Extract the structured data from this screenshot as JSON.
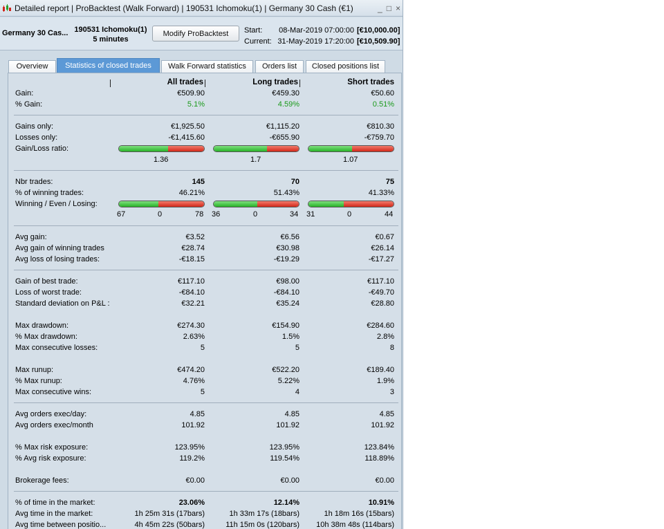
{
  "window": {
    "title": "Detailed report | ProBacktest (Walk Forward) | 190531 Ichomoku(1) | Germany 30 Cash (€1)",
    "minimize": "_",
    "maximize": "□",
    "close": "×"
  },
  "info": {
    "instrument": "Germany 30 Cas...",
    "system_name": "190531 Ichomoku(1)",
    "timeframe": "5 minutes",
    "modify_button": "Modify ProBacktest",
    "start_label": "Start:",
    "start_date": "08-Mar-2019 07:00:00",
    "start_amount": "[€10,000.00]",
    "current_label": "Current:",
    "current_date": "31-May-2019 17:20:00",
    "current_amount": "[€10,509.90]"
  },
  "tabs": [
    "Overview",
    "Statistics of closed trades",
    "Walk Forward statistics",
    "Orders list",
    "Closed positions list"
  ],
  "columns": [
    "All trades",
    "Long trades",
    "Short trades"
  ],
  "stats": {
    "gain": [
      "Gain:",
      "€509.90",
      "€459.30",
      "€50.60"
    ],
    "pct_gain": [
      "% Gain:",
      "5.1%",
      "4.59%",
      "0.51%"
    ],
    "gains_only": [
      "Gains only:",
      "€1,925.50",
      "€1,115.20",
      "€810.30"
    ],
    "losses_only": [
      "Losses only:",
      "-€1,415.60",
      "-€655.90",
      "-€759.70"
    ],
    "gain_loss_ratio": [
      "Gain/Loss ratio:",
      "1.36",
      "1.7",
      "1.07"
    ],
    "nbr_trades": [
      "Nbr trades:",
      "145",
      "70",
      "75"
    ],
    "pct_winning": [
      "% of winning trades:",
      "46.21%",
      "51.43%",
      "41.33%"
    ],
    "wel_label": "Winning / Even / Losing:",
    "wel": [
      [
        "67",
        "0",
        "78"
      ],
      [
        "36",
        "0",
        "34"
      ],
      [
        "31",
        "0",
        "44"
      ]
    ],
    "avg_gain": [
      "Avg gain:",
      "€3.52",
      "€6.56",
      "€0.67"
    ],
    "avg_gain_win": [
      "Avg gain of winning trades",
      "€28.74",
      "€30.98",
      "€26.14"
    ],
    "avg_loss_lose": [
      "Avg loss of losing trades:",
      "-€18.15",
      "-€19.29",
      "-€17.27"
    ],
    "best_trade": [
      "Gain of best trade:",
      "€117.10",
      "€98.00",
      "€117.10"
    ],
    "worst_trade": [
      "Loss of worst trade:",
      "-€84.10",
      "-€84.10",
      "-€49.70"
    ],
    "std_dev": [
      "Standard deviation on P&L :",
      "€32.21",
      "€35.24",
      "€28.80"
    ],
    "max_dd": [
      "Max drawdown:",
      "€274.30",
      "€154.90",
      "€284.60"
    ],
    "pct_max_dd": [
      "% Max drawdown:",
      "2.63%",
      "1.5%",
      "2.8%"
    ],
    "max_consec_losses": [
      "Max consecutive losses:",
      "5",
      "5",
      "8"
    ],
    "max_runup": [
      "Max runup:",
      "€474.20",
      "€522.20",
      "€189.40"
    ],
    "pct_max_runup": [
      "% Max runup:",
      "4.76%",
      "5.22%",
      "1.9%"
    ],
    "max_consec_wins": [
      "Max consecutive wins:",
      "5",
      "4",
      "3"
    ],
    "avg_exec_day": [
      "Avg orders exec/day:",
      "4.85",
      "4.85",
      "4.85"
    ],
    "avg_exec_month": [
      "Avg orders exec/month",
      "101.92",
      "101.92",
      "101.92"
    ],
    "max_risk": [
      "% Max risk exposure:",
      "123.95%",
      "123.95%",
      "123.84%"
    ],
    "avg_risk": [
      "% Avg risk exposure:",
      "119.2%",
      "119.54%",
      "118.89%"
    ],
    "brokerage": [
      "Brokerage fees:",
      "€0.00",
      "€0.00",
      "€0.00"
    ],
    "time_market": [
      "% of time in the market:",
      "23.06%",
      "12.14%",
      "10.91%"
    ],
    "avg_time_market": [
      "Avg time in the market:",
      "1h 25m 31s (17bars)",
      "1h 33m 17s (18bars)",
      "1h 18m 16s (15bars)"
    ],
    "avg_time_between": [
      "Avg time between positio...",
      "4h 45m 22s (50bars)",
      "11h 15m 0s (120bars)",
      "10h 38m 48s (114bars)"
    ]
  },
  "ratios": {
    "gain_loss_green_fraction": [
      0.576,
      0.63,
      0.516
    ],
    "winning_fraction": [
      0.462,
      0.514,
      0.413
    ]
  },
  "colors": {
    "positive": "#1a9a1a",
    "active_tab": "#5c99d6"
  }
}
